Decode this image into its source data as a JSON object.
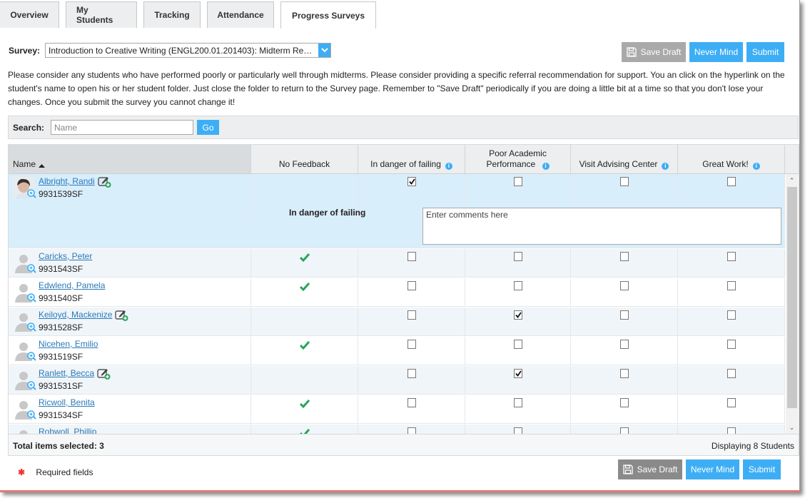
{
  "tabs": [
    {
      "label": "Overview",
      "active": false
    },
    {
      "label": "My Students",
      "active": false
    },
    {
      "label": "Tracking",
      "active": false
    },
    {
      "label": "Attendance",
      "active": false
    },
    {
      "label": "Progress Surveys",
      "active": true
    }
  ],
  "survey": {
    "label": "Survey:",
    "selected": "Introduction to Creative Writing (ENGL200.01.201403): Midterm Re…"
  },
  "actions": {
    "save_draft": "Save Draft",
    "never_mind": "Never Mind",
    "submit": "Submit"
  },
  "instructions": "Please consider any students who have performed poorly or particularly well through midterms. Please consider providing a specific referral recommendation for support. You an click on the hyperlink on the student's name to open his or her student folder. Just close the folder to return to the Survey page. Remember to \"Save Draft\" periodically if you are doing a little bit at a time so that you don't lose your changes. Once you submit the survey you cannot change it!",
  "search": {
    "label": "Search:",
    "placeholder": "Name",
    "value": "",
    "go_label": "Go"
  },
  "table": {
    "columns": {
      "name": "Name",
      "no_feedback": "No Feedback",
      "danger": "In danger of failing",
      "poor_line1": "Poor Academic",
      "poor_line2": "Performance",
      "advising": "Visit Advising Center",
      "great": "Great Work!"
    },
    "sort": {
      "column": "Name",
      "direction": "ascending"
    },
    "rows": [
      {
        "name": "Albright, Randi",
        "id": "9931539SF",
        "photo": true,
        "note": true,
        "no_feedback": false,
        "danger": true,
        "poor": false,
        "advising": false,
        "great": false,
        "selected": true,
        "comment_label": "In danger of failing",
        "comment_placeholder": "Enter comments here"
      },
      {
        "name": "Caricks, Peter",
        "id": "9931543SF",
        "photo": false,
        "note": false,
        "no_feedback": true,
        "danger": false,
        "poor": false,
        "advising": false,
        "great": false
      },
      {
        "name": "Edwlend, Pamela",
        "id": "9931540SF",
        "photo": false,
        "note": false,
        "no_feedback": true,
        "danger": false,
        "poor": false,
        "advising": false,
        "great": false
      },
      {
        "name": "Keiloyd, Mackenize",
        "id": "9931528SF",
        "photo": false,
        "note": true,
        "no_feedback": false,
        "danger": false,
        "poor": true,
        "advising": false,
        "great": false
      },
      {
        "name": "Nicehen, Emilio",
        "id": "9931519SF",
        "photo": false,
        "note": false,
        "no_feedback": true,
        "danger": false,
        "poor": false,
        "advising": false,
        "great": false
      },
      {
        "name": "Ranlett, Becca",
        "id": "9931531SF",
        "photo": false,
        "note": true,
        "no_feedback": false,
        "danger": false,
        "poor": true,
        "advising": false,
        "great": false
      },
      {
        "name": "Ricwoll, Benita",
        "id": "9931534SF",
        "photo": false,
        "note": false,
        "no_feedback": true,
        "danger": false,
        "poor": false,
        "advising": false,
        "great": false
      },
      {
        "name": "Robwoll, Phillip",
        "id": "",
        "photo": false,
        "note": false,
        "no_feedback": true,
        "danger": false,
        "poor": false,
        "advising": false,
        "great": false
      }
    ],
    "footer": {
      "total_selected": "Total items selected: 3",
      "displaying": "Displaying 8 Students"
    }
  },
  "required_note": "Required fields",
  "colors": {
    "accent": "#3daef5",
    "link": "#2a7ab8",
    "selected_row": "#d9eefb",
    "check_green": "#27a65a",
    "required_star": "#e33333"
  }
}
